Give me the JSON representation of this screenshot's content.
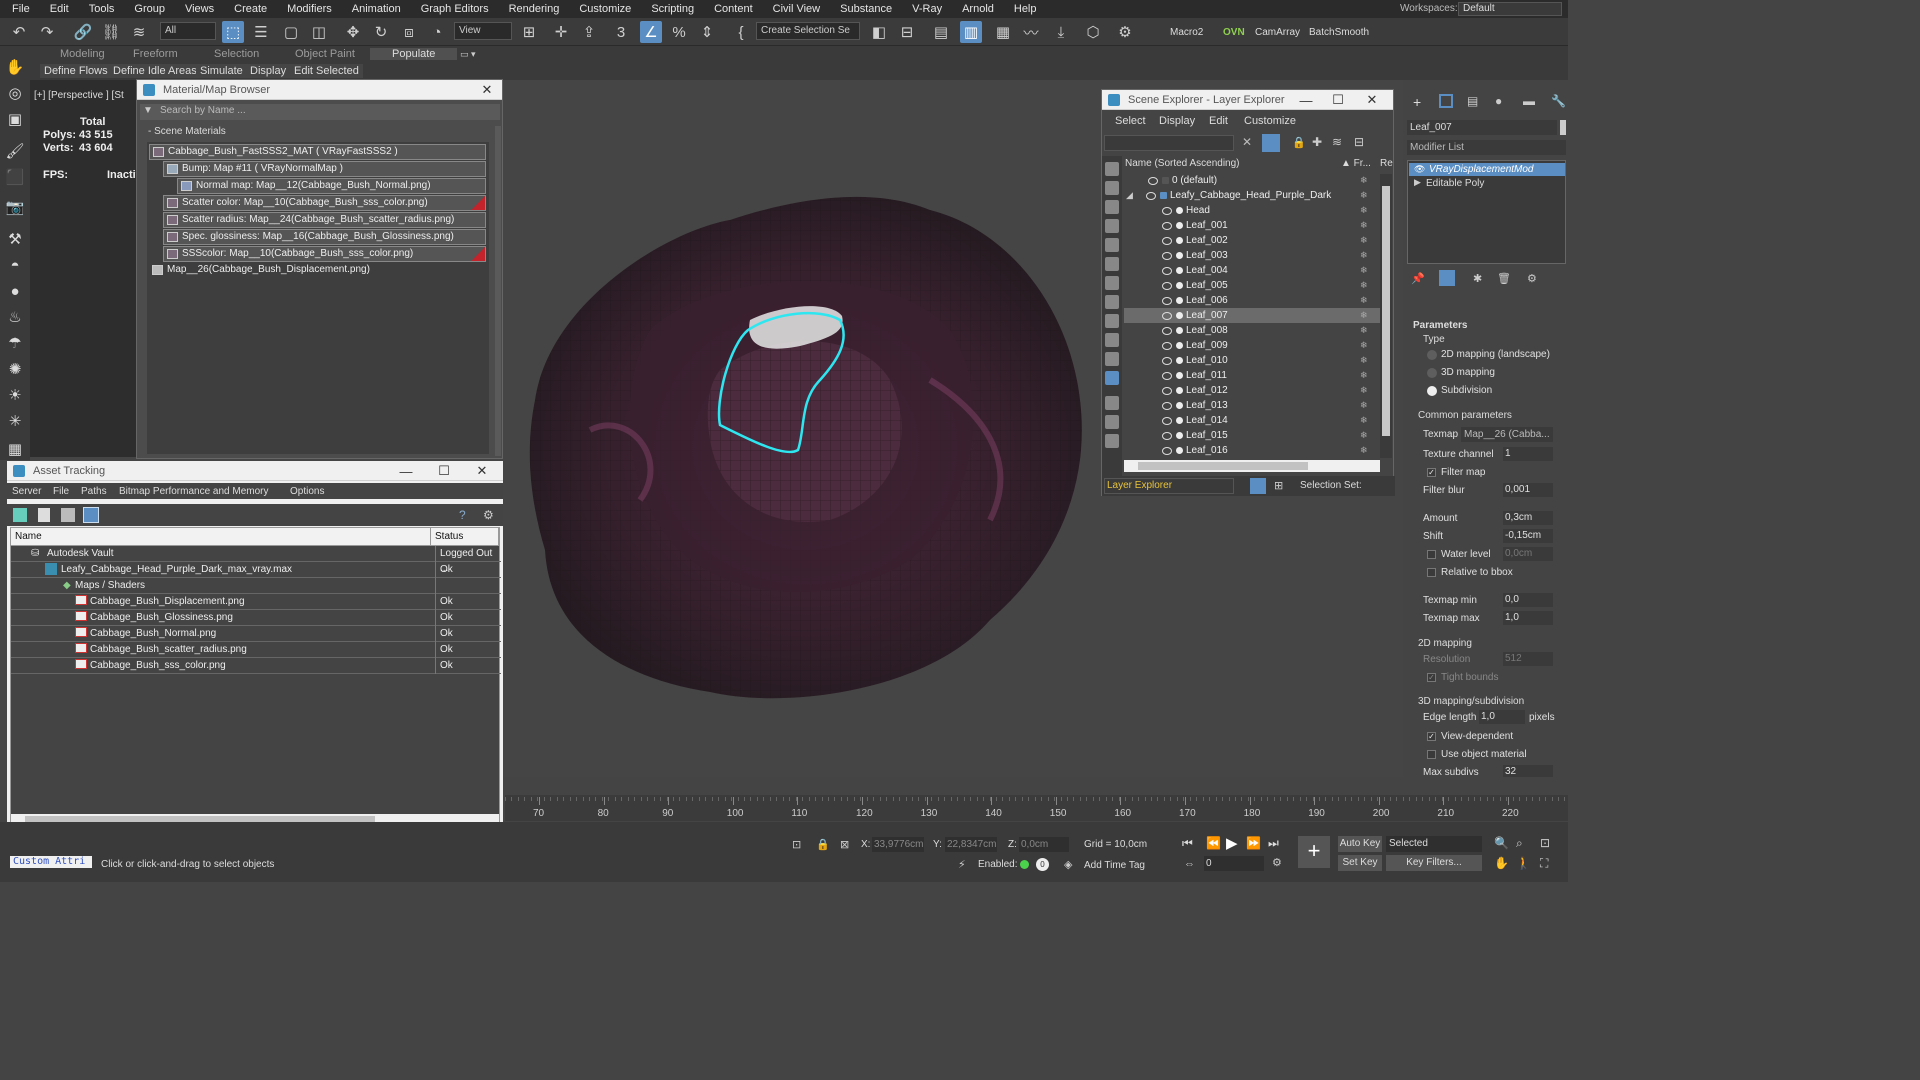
{
  "menu": [
    "File",
    "Edit",
    "Tools",
    "Group",
    "Views",
    "Create",
    "Modifiers",
    "Animation",
    "Graph Editors",
    "Rendering",
    "Customize",
    "Scripting",
    "Content",
    "Civil View",
    "Substance",
    "V-Ray",
    "Arnold",
    "Help"
  ],
  "workspaces": {
    "label": "Workspaces:",
    "value": "Default"
  },
  "toolbar": {
    "filter": "All",
    "view": "View",
    "selset": "Create Selection Se",
    "macro2": "Macro2",
    "ovn": "OVN",
    "camarray": "CamArray",
    "batch": "BatchSmooth"
  },
  "ribbon": {
    "tabs": [
      "Modeling",
      "Freeform",
      "Selection",
      "Object Paint",
      "Populate"
    ],
    "sub": [
      "Define Flows",
      "Define Idle Areas",
      "Simulate",
      "Display",
      "Edit Selected"
    ]
  },
  "viewport": {
    "label": "[+] [Perspective ] [St",
    "stats": {
      "total": "Total",
      "polys_label": "Polys:",
      "polys": "43 515",
      "verts_label": "Verts:",
      "verts": "43 604",
      "fps_label": "FPS:",
      "fps": "Inactive"
    }
  },
  "material_browser": {
    "title": "Material/Map Browser",
    "search": "Search by Name ...",
    "section": "- Scene Materials",
    "rows": [
      "Cabbage_Bush_FastSSS2_MAT  ( VRayFastSSS2 )",
      "Bump: Map #11  ( VRayNormalMap )",
      "Normal map: Map__12(Cabbage_Bush_Normal.png)",
      "Scatter color: Map__10(Cabbage_Bush_sss_color.png)",
      "Scatter radius: Map__24(Cabbage_Bush_scatter_radius.png)",
      "Spec. glossiness: Map__16(Cabbage_Bush_Glossiness.png)",
      "SSScolor: Map__10(Cabbage_Bush_sss_color.png)",
      "Map__26(Cabbage_Bush_Displacement.png)"
    ]
  },
  "asset_tracking": {
    "title": "Asset Tracking",
    "menu": [
      "Server",
      "File",
      "Paths",
      "Bitmap Performance and Memory",
      "Options"
    ],
    "col_name": "Name",
    "col_status": "Status",
    "rows": [
      {
        "name": "Autodesk Vault",
        "status": "Logged Out ..."
      },
      {
        "name": "Leafy_Cabbage_Head_Purple_Dark_max_vray.max",
        "status": "Ok"
      },
      {
        "name": "Maps / Shaders",
        "status": ""
      },
      {
        "name": "Cabbage_Bush_Displacement.png",
        "status": "Ok"
      },
      {
        "name": "Cabbage_Bush_Glossiness.png",
        "status": "Ok"
      },
      {
        "name": "Cabbage_Bush_Normal.png",
        "status": "Ok"
      },
      {
        "name": "Cabbage_Bush_scatter_radius.png",
        "status": "Ok"
      },
      {
        "name": "Cabbage_Bush_sss_color.png",
        "status": "Ok"
      }
    ]
  },
  "scene_explorer": {
    "title": "Scene Explorer - Layer Explorer",
    "menu": [
      "Select",
      "Display",
      "Edit",
      "Customize"
    ],
    "col_name": "Name (Sorted Ascending)",
    "col_fr": "▲ Fr...",
    "col_re": "Re",
    "layers": [
      "0 (default)",
      "Leafy_Cabbage_Head_Purple_Dark"
    ],
    "objects": [
      "Head",
      "Leaf_001",
      "Leaf_002",
      "Leaf_003",
      "Leaf_004",
      "Leaf_005",
      "Leaf_006",
      "Leaf_007",
      "Leaf_008",
      "Leaf_009",
      "Leaf_010",
      "Leaf_011",
      "Leaf_012",
      "Leaf_013",
      "Leaf_014",
      "Leaf_015",
      "Leaf_016"
    ],
    "selected": "Leaf_007",
    "bottom_mode": "Layer Explorer",
    "selection_set": "Selection Set:"
  },
  "command_panel": {
    "object_name": "Leaf_007",
    "modifier_list": "Modifier List",
    "stack": [
      "VRayDisplacementMod",
      "Editable Poly"
    ],
    "params_title": "Parameters",
    "type_label": "Type",
    "types": [
      "2D mapping (landscape)",
      "3D mapping",
      "Subdivision"
    ],
    "type_selected": "Subdivision",
    "common": "Common parameters",
    "texmap_label": "Texmap",
    "texmap_value": "Map__26 (Cabba...",
    "texch_label": "Texture channel",
    "texch_value": "1",
    "filter_map": "Filter map",
    "filter_blur_label": "Filter blur",
    "filter_blur": "0,001",
    "amount_label": "Amount",
    "amount": "0,3cm",
    "shift_label": "Shift",
    "shift": "-0,15cm",
    "water_label": "Water level",
    "water": "0,0cm",
    "relbbox": "Relative to bbox",
    "texmin_label": "Texmap min",
    "texmin": "0,0",
    "texmax_label": "Texmap max",
    "texmax": "1,0",
    "map2d": "2D mapping",
    "res_label": "Resolution",
    "res": "512",
    "tight": "Tight bounds",
    "map3d": "3D mapping/subdivision",
    "edge_label": "Edge length",
    "edge": "1,0",
    "pixels": "pixels",
    "viewdep": "View-dependent",
    "useobj": "Use object material",
    "maxsub_label": "Max subdivs",
    "maxsub": "32"
  },
  "timeline": {
    "ticks": [
      "70",
      "80",
      "90",
      "100",
      "110",
      "120",
      "130",
      "140",
      "150",
      "160",
      "170",
      "180",
      "190",
      "200",
      "210",
      "220"
    ]
  },
  "status": {
    "custom": "Custom Attri",
    "prompt": "Click or click-and-drag to select objects",
    "x_label": "X:",
    "x": "33,9776cm",
    "y_label": "Y:",
    "y": "22,8347cm",
    "z_label": "Z:",
    "z": "0,0cm",
    "grid": "Grid = 10,0cm",
    "enabled": "Enabled:",
    "addtime": "Add Time Tag",
    "autokey": "Auto Key",
    "setkey": "Set Key",
    "selected": "Selected",
    "keyfilters": "Key Filters...",
    "frame": "0"
  },
  "colors": {
    "accent": "#5b8fc4",
    "selection_outline": "#2ee6f0",
    "layer_text": "#e8c33a"
  }
}
